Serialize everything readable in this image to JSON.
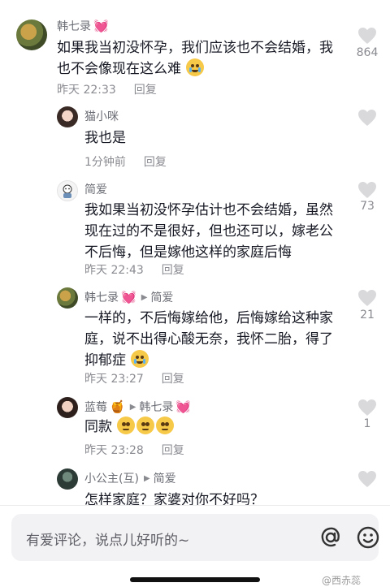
{
  "comments": [
    {
      "username": "韩七录",
      "name_emoji": "💓",
      "text": "如果我当初没怀孕，我们应该也不会结婚，我也不会像现在这么难",
      "time": "昨天 22:33",
      "reply_label": "回复",
      "likes": "864"
    },
    {
      "username": "猫小咪",
      "text": "我也是",
      "time": "1分钟前",
      "reply_label": "回复"
    },
    {
      "username": "简爱",
      "text": "我如果当初没怀孕估计也不会结婚，虽然现在过的不是很好，但也还可以，嫁老公不后悔，但是嫁他这样的家庭后悔",
      "time": "昨天 22:43",
      "reply_label": "回复",
      "likes": "73"
    },
    {
      "username": "韩七录",
      "name_emoji": "💓",
      "reply_to": "简爱",
      "text": "一样的，不后悔嫁给他，后悔嫁给这种家庭，说不出得心酸无奈，我怀二胎，得了抑郁症",
      "time": "昨天 23:27",
      "reply_label": "回复",
      "likes": "21"
    },
    {
      "username": "蓝莓",
      "name_emoji": "🍯",
      "reply_to": "韩七录",
      "reply_to_emoji": "💓",
      "text": "同款",
      "time": "昨天 23:28",
      "reply_label": "回复",
      "likes": "1"
    },
    {
      "username": "小公主(互)",
      "reply_to": "简爱",
      "text": "怎样家庭？家婆对你不好吗？"
    }
  ],
  "input": {
    "placeholder": "有爱评论，说点儿好听的~"
  },
  "watermark": "@西赤蕊",
  "icons": {
    "like": "heart-icon",
    "at": "at-sign-icon",
    "emoji": "smiley-icon",
    "reply_arrow": "triangle-right-icon"
  },
  "colors": {
    "text": "#161823",
    "secondary": "#8a8b91",
    "heart": "#d9d9dc",
    "input_bg": "#f2f2f4"
  }
}
